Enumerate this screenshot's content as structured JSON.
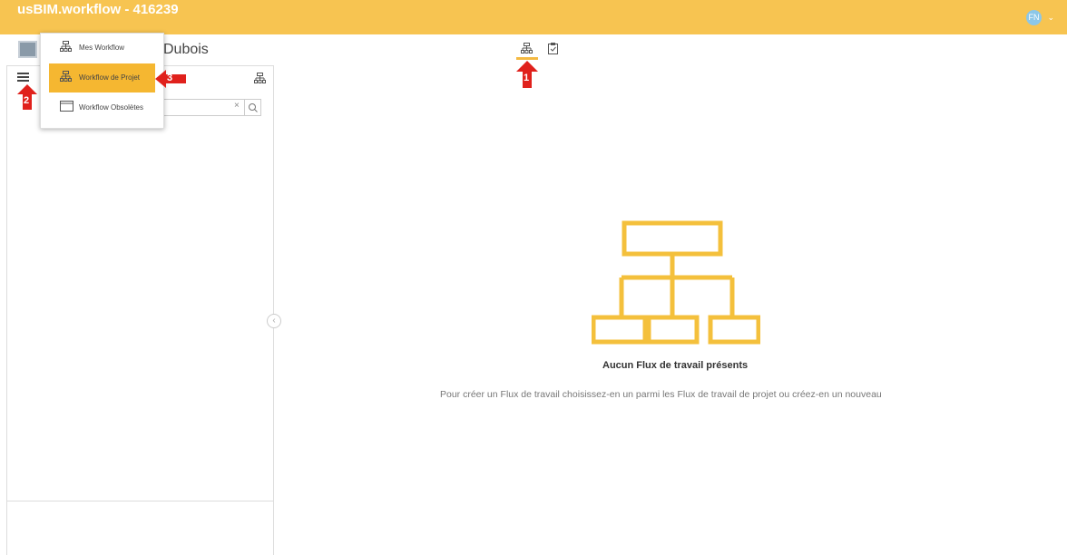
{
  "app": {
    "title": "usBIM.workflow - 416239",
    "user_initials": "FN",
    "user_menu_icon": "chevron-down-icon",
    "accent_color": "#f7c451"
  },
  "header": {
    "project_name": "Dubois",
    "view_tabs": [
      {
        "icon": "workflow-tree-icon",
        "active": true
      },
      {
        "icon": "clipboard-check-icon",
        "active": false
      }
    ]
  },
  "sidebar": {
    "menu_icon": "hamburger-icon",
    "tree_icon": "workflow-tree-icon",
    "search": {
      "value": "",
      "clear": "×"
    },
    "collapse_icon": "chevron-left-icon"
  },
  "dropdown": {
    "items": [
      {
        "label": "Mes Workflow",
        "icon": "workflow-tree-icon",
        "active": false
      },
      {
        "label": "Workflow de Projet",
        "icon": "workflow-tree-icon",
        "active": true
      },
      {
        "label": "Workflow Obsolètes",
        "icon": "window-icon",
        "active": false
      }
    ]
  },
  "annotations": [
    {
      "number": "1",
      "color": "#e0211c"
    },
    {
      "number": "2",
      "color": "#e0211c"
    },
    {
      "number": "3",
      "color": "#e0211c"
    }
  ],
  "empty_state": {
    "title": "Aucun Flux de travail présents",
    "description": "Pour créer un Flux de travail choisissez-en un parmi les Flux de travail de projet ou créez-en un nouveau",
    "icon": "workflow-hierarchy-icon",
    "icon_color": "#f4c03c"
  }
}
